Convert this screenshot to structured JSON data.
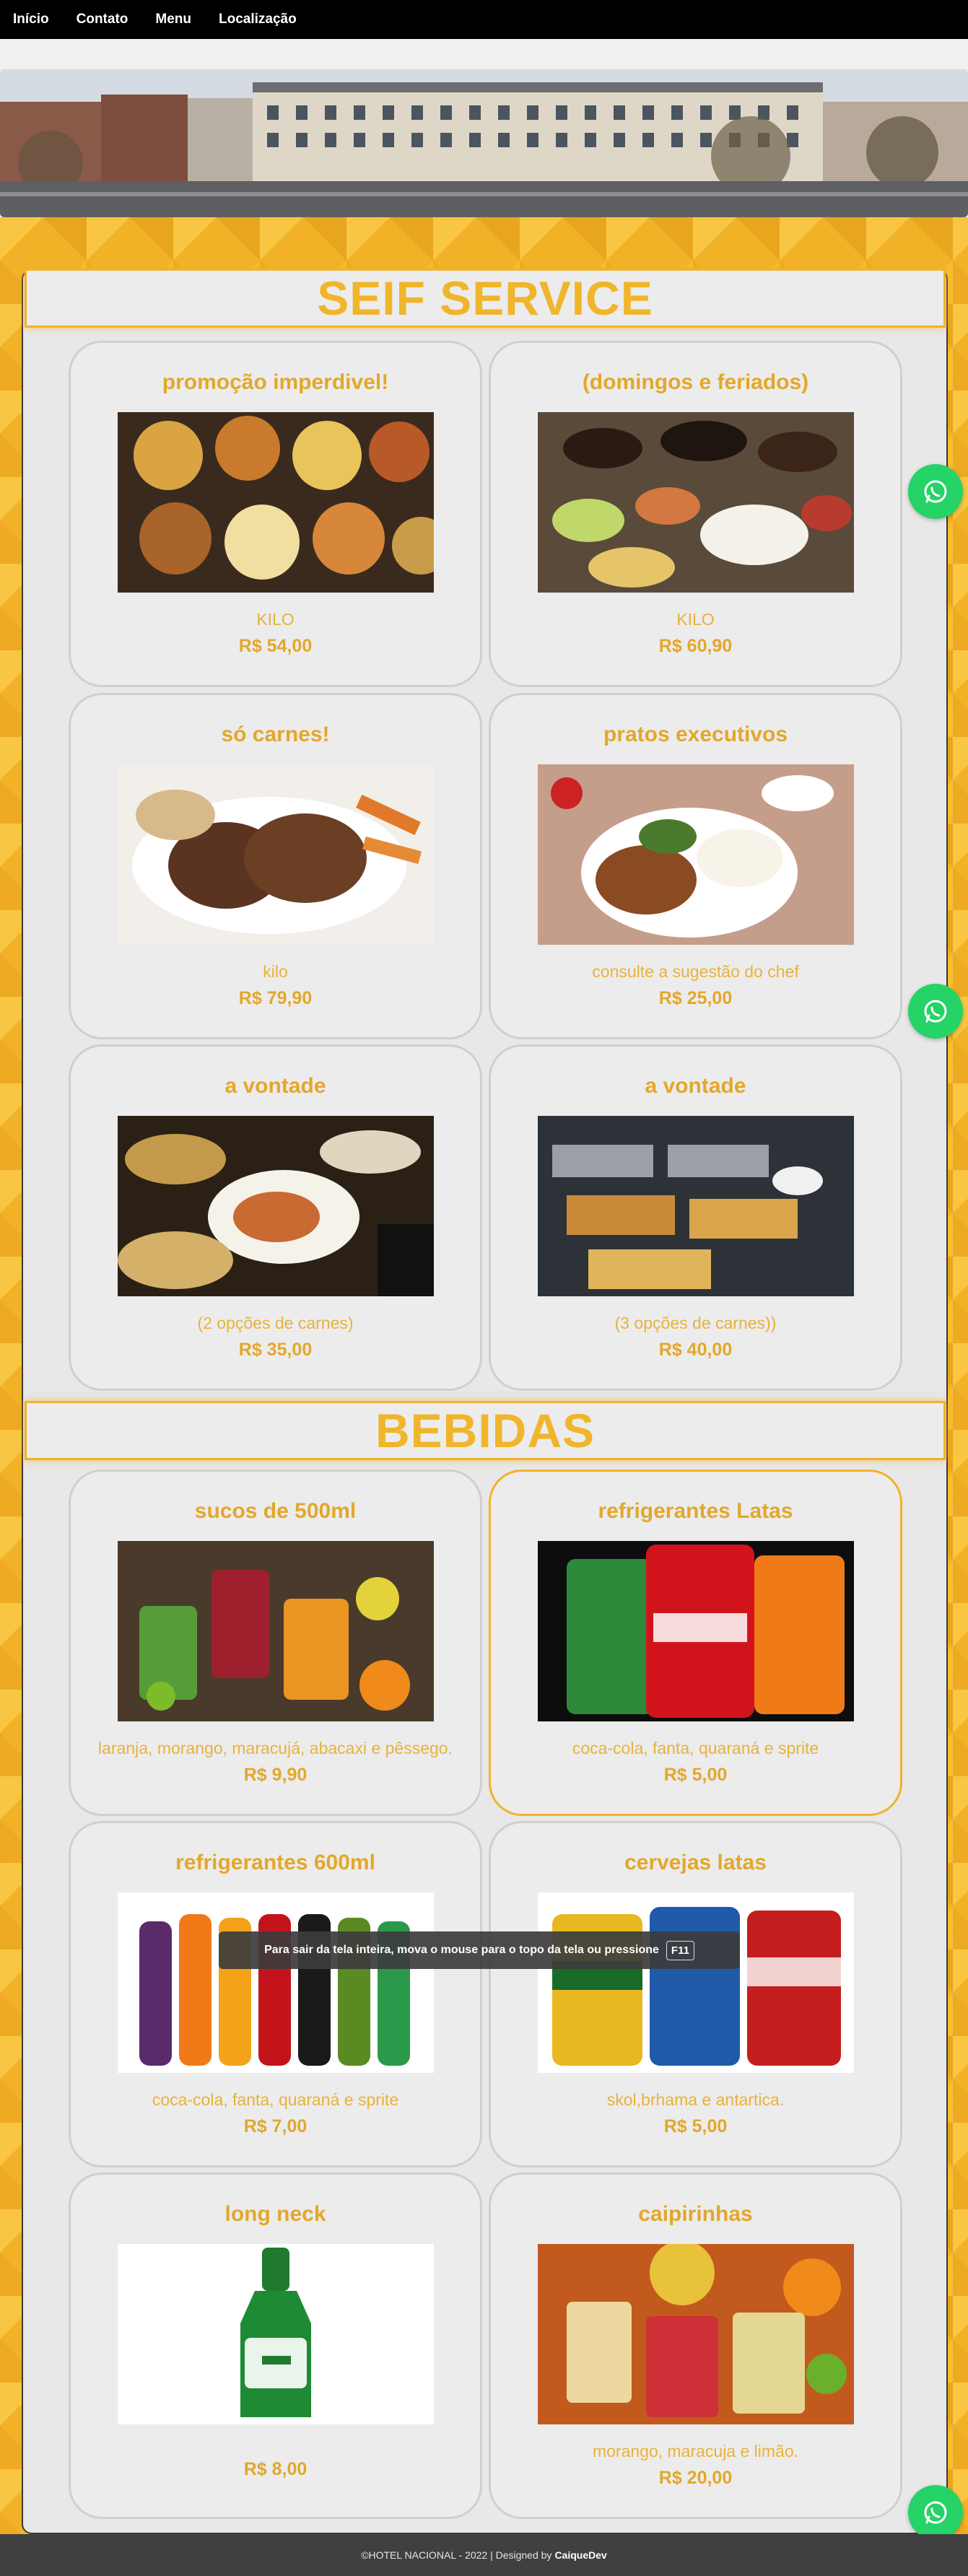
{
  "nav": {
    "items": [
      "Início",
      "Contato",
      "Menu",
      "Localização"
    ]
  },
  "sections": {
    "food_title": "SEIF SERVICE",
    "drinks_title": "BEBIDAS"
  },
  "food": [
    {
      "title": "promoção imperdivel!",
      "desc": "KILO",
      "price": "R$ 54,00",
      "image": "buffet-pans"
    },
    {
      "title": "(domingos e feriados)",
      "desc": "KILO",
      "price": "R$ 60,90",
      "image": "feijoada-table"
    },
    {
      "title": "só carnes!",
      "desc": "kilo",
      "price": "R$ 79,90",
      "image": "roast-meat"
    },
    {
      "title": "pratos executivos",
      "desc": "consulte a sugestão do chef",
      "price": "R$ 25,00",
      "image": "chicken-plate"
    },
    {
      "title": "a vontade",
      "desc": "(2 opções de carnes)",
      "price": "R$ 35,00",
      "image": "buffet-plate"
    },
    {
      "title": "a vontade",
      "desc": "(3 opções de carnes))",
      "price": "R$ 40,00",
      "image": "buffet-line"
    }
  ],
  "drinks": [
    {
      "title": "sucos de 500ml",
      "desc": "laranja, morango, maracujá, abacaxi e pêssego.",
      "price": "R$ 9,90",
      "image": "juices"
    },
    {
      "title": "refrigerantes Latas",
      "desc": "coca-cola, fanta, quaraná e sprite",
      "price": "R$ 5,00",
      "image": "soda-cans"
    },
    {
      "title": "refrigerantes 600ml",
      "desc": "coca-cola, fanta, quaraná e sprite",
      "price": "R$ 7,00",
      "image": "soda-bottles"
    },
    {
      "title": "cervejas latas",
      "desc": "skol,brhama e antartica.",
      "price": "R$ 5,00",
      "image": "beer-cans"
    },
    {
      "title": "long neck",
      "desc": "",
      "price": "R$ 8,00",
      "image": "heineken-bottle"
    },
    {
      "title": "caipirinhas",
      "desc": "morango, maracuja e limão.",
      "price": "R$ 20,00",
      "image": "caipirinhas"
    }
  ],
  "toast": {
    "text": "Para sair da tela inteira, mova o mouse para o topo da tela ou pressione",
    "key": "F11"
  },
  "footer": {
    "text": "©HOTEL NACIONAL - 2022 | Designed by",
    "author": "CaiqueDev"
  },
  "colors": {
    "accent": "#f2b227",
    "title_text": "#e3a72b",
    "whatsapp": "#25d366"
  }
}
